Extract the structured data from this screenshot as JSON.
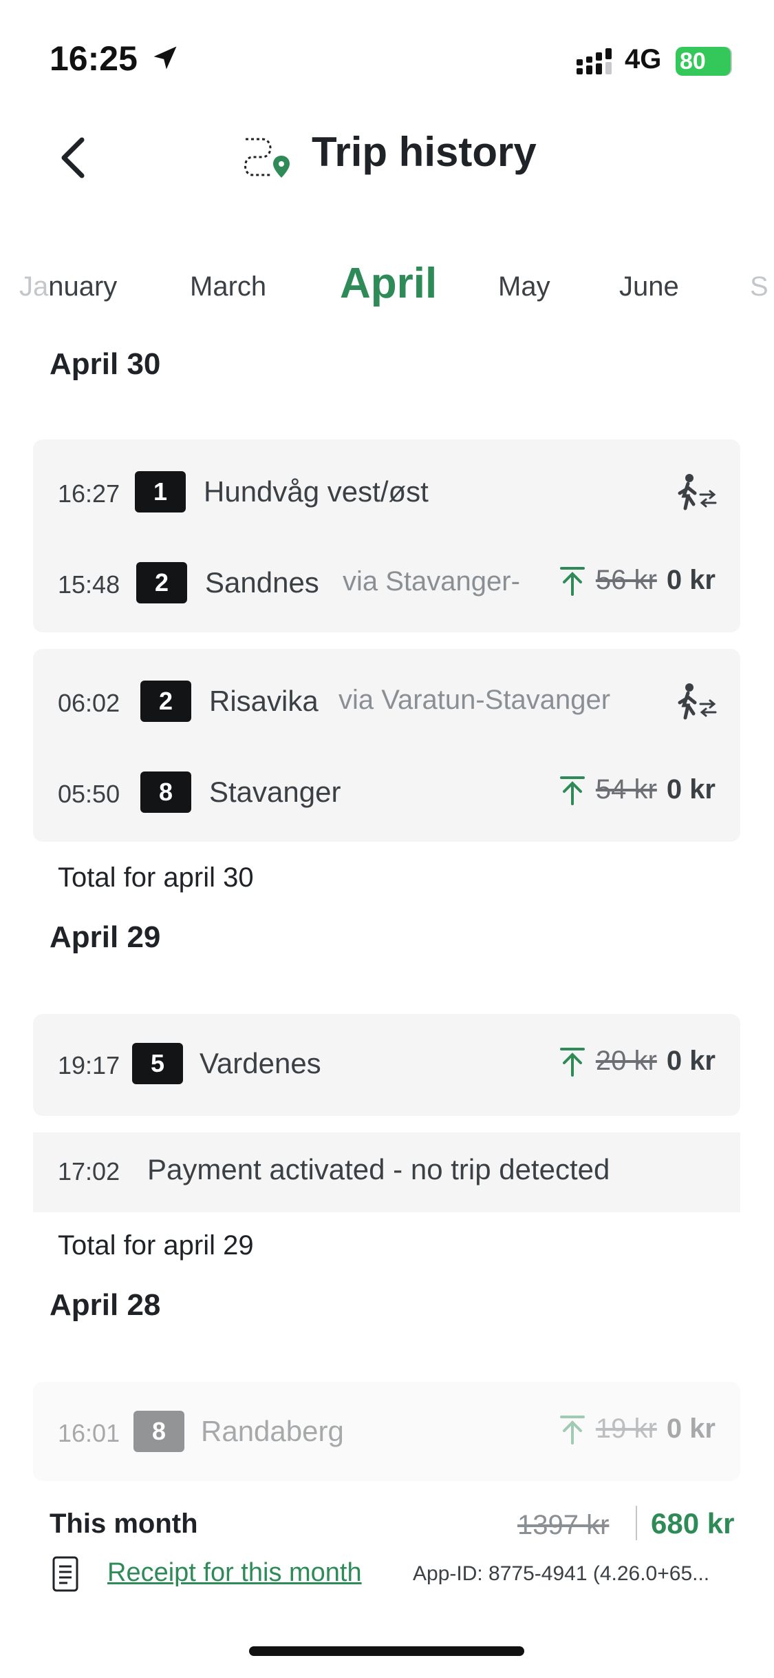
{
  "status": {
    "time": "16:25",
    "network": "4G",
    "battery": "80"
  },
  "header": {
    "title": "Trip history"
  },
  "months": [
    {
      "label": "January",
      "state": "faded-left"
    },
    {
      "label": "March",
      "state": "normal"
    },
    {
      "label": "April",
      "state": "active"
    },
    {
      "label": "May",
      "state": "normal"
    },
    {
      "label": "June",
      "state": "normal"
    },
    {
      "label": "S",
      "state": "faded-right"
    }
  ],
  "days": [
    {
      "title": "April 30",
      "cards": [
        {
          "rows": [
            {
              "time": "16:27",
              "line": "1",
              "dest": "Hundvåg vest/øst",
              "via": "",
              "icon": "transfer-icon"
            },
            {
              "time": "15:48",
              "line": "2",
              "dest": "Sandnes",
              "via": "via Stavanger-",
              "old_price": "56 kr",
              "new_price": "0 kr",
              "icon": "arrow-up-icon"
            }
          ]
        },
        {
          "rows": [
            {
              "time": "06:02",
              "line": "2",
              "dest": "Risavika",
              "via": "via Varatun-Stavanger",
              "icon": "transfer-icon"
            },
            {
              "time": "05:50",
              "line": "8",
              "dest": "Stavanger",
              "via": "",
              "old_price": "54 kr",
              "new_price": "0 kr",
              "icon": "arrow-up-icon"
            }
          ]
        }
      ],
      "total_label": "Total for april 30"
    },
    {
      "title": "April 29",
      "cards": [
        {
          "rows": [
            {
              "time": "19:17",
              "line": "5",
              "dest": "Vardenes",
              "via": "",
              "old_price": "20 kr",
              "new_price": "0 kr",
              "icon": "arrow-up-icon"
            }
          ]
        }
      ],
      "payment": {
        "time": "17:02",
        "text": "Payment activated - no trip detected"
      },
      "total_label": "Total for april 29"
    },
    {
      "title": "April 28",
      "cards": [
        {
          "rows": [
            {
              "time": "16:01",
              "line": "8",
              "dest": "Randaberg",
              "via": "",
              "old_price": "19 kr",
              "new_price": "0 kr",
              "icon": "arrow-up-icon"
            }
          ]
        }
      ]
    }
  ],
  "summary": {
    "label": "This month",
    "old_total": "1397 kr",
    "new_total": "680 kr",
    "receipt_label": "Receipt for this month",
    "app_id": "App-ID: 8775-4941 (4.26.0+65..."
  },
  "colors": {
    "accent": "#2e8b57",
    "card": "#f5f5f6",
    "badge": "#121416"
  }
}
